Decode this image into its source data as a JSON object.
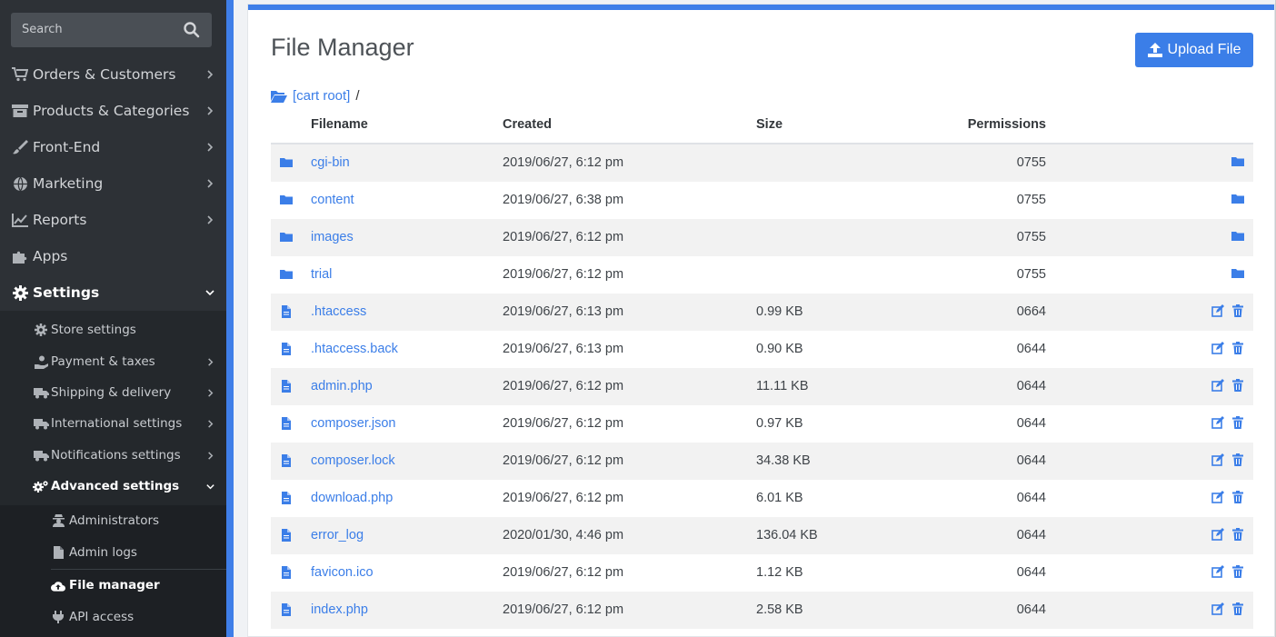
{
  "sidebar": {
    "search_placeholder": "Search",
    "items": [
      {
        "label": "Orders & Customers",
        "icon": "cart-icon"
      },
      {
        "label": "Products & Categories",
        "icon": "archive-icon"
      },
      {
        "label": "Front-End",
        "icon": "brush-icon"
      },
      {
        "label": "Marketing",
        "icon": "globe-icon"
      },
      {
        "label": "Reports",
        "icon": "chart-line-icon"
      },
      {
        "label": "Apps",
        "icon": "puzzle-icon"
      },
      {
        "label": "Settings",
        "icon": "gear-icon"
      }
    ],
    "settings_sub": [
      {
        "label": "Store settings",
        "icon": "gear-icon"
      },
      {
        "label": "Payment & taxes",
        "icon": "hand-coin-icon"
      },
      {
        "label": "Shipping & delivery",
        "icon": "truck-icon"
      },
      {
        "label": "International settings",
        "icon": "truck-icon"
      },
      {
        "label": "Notifications settings",
        "icon": "truck-icon"
      },
      {
        "label": "Advanced settings",
        "icon": "gears-icon"
      }
    ],
    "advanced_sub": [
      {
        "label": "Administrators",
        "icon": "user-secret-icon"
      },
      {
        "label": "Admin logs",
        "icon": "file-icon"
      },
      {
        "label": "File manager",
        "icon": "cloud-upload-icon"
      },
      {
        "label": "API access",
        "icon": "plug-icon"
      }
    ]
  },
  "colors": {
    "accent": "#3b7ee8",
    "sidebar_bg": "#2d3136"
  },
  "main": {
    "title": "File Manager",
    "upload_button": "Upload File",
    "breadcrumb": {
      "root": "[cart root]",
      "separator": "/"
    },
    "columns": [
      "Filename",
      "Created",
      "Size",
      "Permissions"
    ],
    "rows": [
      {
        "name": "cgi-bin",
        "type": "folder",
        "created": "2019/06/27, 6:12 pm",
        "size": "",
        "perm": "0755"
      },
      {
        "name": "content",
        "type": "folder",
        "created": "2019/06/27, 6:38 pm",
        "size": "",
        "perm": "0755"
      },
      {
        "name": "images",
        "type": "folder",
        "created": "2019/06/27, 6:12 pm",
        "size": "",
        "perm": "0755"
      },
      {
        "name": "trial",
        "type": "folder",
        "created": "2019/06/27, 6:12 pm",
        "size": "",
        "perm": "0755"
      },
      {
        "name": ".htaccess",
        "type": "file",
        "created": "2019/06/27, 6:13 pm",
        "size": "0.99 KB",
        "perm": "0664"
      },
      {
        "name": ".htaccess.back",
        "type": "file",
        "created": "2019/06/27, 6:13 pm",
        "size": "0.90 KB",
        "perm": "0644"
      },
      {
        "name": "admin.php",
        "type": "file",
        "created": "2019/06/27, 6:12 pm",
        "size": "11.11 KB",
        "perm": "0644"
      },
      {
        "name": "composer.json",
        "type": "file",
        "created": "2019/06/27, 6:12 pm",
        "size": "0.97 KB",
        "perm": "0644"
      },
      {
        "name": "composer.lock",
        "type": "file",
        "created": "2019/06/27, 6:12 pm",
        "size": "34.38 KB",
        "perm": "0644"
      },
      {
        "name": "download.php",
        "type": "file",
        "created": "2019/06/27, 6:12 pm",
        "size": "6.01 KB",
        "perm": "0644"
      },
      {
        "name": "error_log",
        "type": "file",
        "created": "2020/01/30, 4:46 pm",
        "size": "136.04 KB",
        "perm": "0644"
      },
      {
        "name": "favicon.ico",
        "type": "file",
        "created": "2019/06/27, 6:12 pm",
        "size": "1.12 KB",
        "perm": "0644"
      },
      {
        "name": "index.php",
        "type": "file",
        "created": "2019/06/27, 6:12 pm",
        "size": "2.58 KB",
        "perm": "0644"
      }
    ]
  }
}
